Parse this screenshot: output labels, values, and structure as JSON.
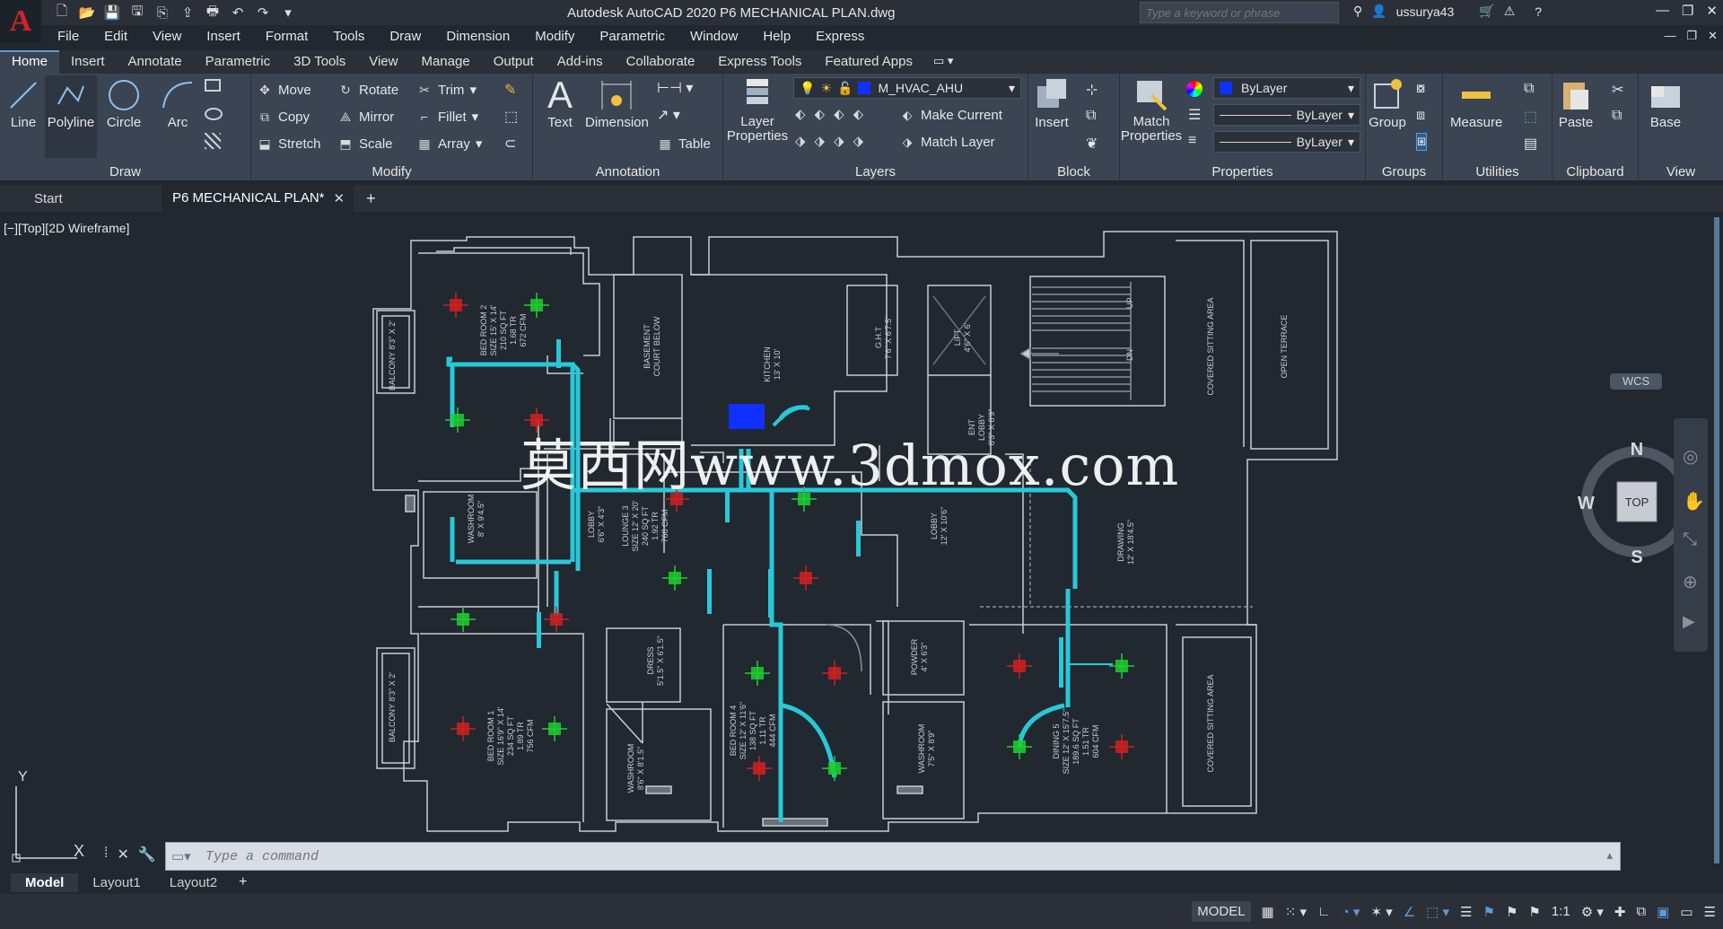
{
  "app": {
    "title": "Autodesk AutoCAD 2020    P6 MECHANICAL PLAN.dwg",
    "search_placeholder": "Type a keyword or phrase",
    "username": "ussurya43",
    "logo": "A"
  },
  "menu": [
    "File",
    "Edit",
    "View",
    "Insert",
    "Format",
    "Tools",
    "Draw",
    "Dimension",
    "Modify",
    "Parametric",
    "Window",
    "Help",
    "Express"
  ],
  "ribbon_tabs": [
    "Home",
    "Insert",
    "Annotate",
    "Parametric",
    "3D Tools",
    "View",
    "Manage",
    "Output",
    "Add-ins",
    "Collaborate",
    "Express Tools",
    "Featured Apps"
  ],
  "ribbon": {
    "draw": {
      "label": "Draw",
      "line": "Line",
      "polyline": "Polyline",
      "circle": "Circle",
      "arc": "Arc"
    },
    "modify": {
      "label": "Modify",
      "move": "Move",
      "rotate": "Rotate",
      "trim": "Trim",
      "copy": "Copy",
      "mirror": "Mirror",
      "fillet": "Fillet",
      "stretch": "Stretch",
      "scale": "Scale",
      "array": "Array"
    },
    "annotation": {
      "label": "Annotation",
      "text": "Text",
      "dimension": "Dimension",
      "table": "Table"
    },
    "layers": {
      "label": "Layers",
      "layer_properties": "Layer Properties",
      "current_layer": "M_HVAC_AHU",
      "make_current": "Make Current",
      "match_layer": "Match Layer"
    },
    "block": {
      "label": "Block",
      "insert": "Insert"
    },
    "properties": {
      "label": "Properties",
      "match_properties": "Match Properties",
      "color": "ByLayer",
      "linetype": "ByLayer",
      "lineweight": "ByLayer"
    },
    "groups": {
      "label": "Groups",
      "group": "Group"
    },
    "utilities": {
      "label": "Utilities",
      "measure": "Measure"
    },
    "clipboard": {
      "label": "Clipboard",
      "paste": "Paste"
    },
    "view": {
      "label": "View",
      "base": "Base"
    }
  },
  "doc_tabs": [
    "Start",
    "P6 MECHANICAL PLAN*"
  ],
  "viewport_label": "[−][Top][2D Wireframe]",
  "watermark": "莫西网www.3dmox.com",
  "compass": {
    "n": "N",
    "s": "S",
    "e": "E",
    "w": "W",
    "top": "TOP",
    "wcs": "WCS"
  },
  "ucs": {
    "y": "Y",
    "x": "X"
  },
  "command_placeholder": "Type a command",
  "layout_tabs": [
    "Model",
    "Layout1",
    "Layout2"
  ],
  "status": {
    "model": "MODEL",
    "scale": "1:1"
  },
  "plan_labels": {
    "bed2": [
      "BED ROOM 2",
      "SIZE 15' X 14'",
      "210 SQ FT",
      "1.68 TR",
      "672 CFM"
    ],
    "basement": [
      "BASEMENT",
      "COURT BELOW"
    ],
    "kitchen": [
      "KITCHEN",
      "13' X 10'"
    ],
    "ghrt": [
      "G.H.T",
      "7'6\" X 6'7.5\""
    ],
    "lift": [
      "LIFT",
      "4'6\" X 6'"
    ],
    "ent_lobby": [
      "ENT",
      "LOBBY",
      "8'3\" X 8'9\""
    ],
    "covered1": "COVERED SITTING AREA",
    "open_terrace": "OPEN TERRACE",
    "balcony1": "BALCONY 8'3\" X 2'",
    "washroom1": [
      "WASHROOM",
      "8' X 9'4.5\""
    ],
    "lobby1": [
      "LOBBY",
      "6'6\" X 4'3\""
    ],
    "lounge": [
      "LOUNGE 3",
      "SIZE 12' X 20'",
      "240 SQ FT",
      "1.92 TR",
      "768 CFM"
    ],
    "lobby2": [
      "LOBBY",
      "12' X 10'6\""
    ],
    "drawing": [
      "DRAWING",
      "12' X 18'4.5\""
    ],
    "balcony2": "BALCONY 8'3\" X 2'",
    "dress": [
      "DRESS",
      "5'1.5\" X 6'1.5\""
    ],
    "powder": [
      "POWDER",
      "4' X 6'3\""
    ],
    "bed1": [
      "BED ROOM 1",
      "SIZE 16'9\" X 14'",
      "234 SQ FT",
      "1.89 TR",
      "756 CFM"
    ],
    "washroom2": [
      "WASHROOM",
      "8'6\" X 8'1.5\""
    ],
    "bed4": [
      "BED ROOM 4",
      "SIZE 12' X 11'6\"",
      "138 SQ FT",
      "1.11 TR",
      "444 CFM"
    ],
    "washroom3": [
      "WASHROOM",
      "7'5\" X 8'9\""
    ],
    "dining": [
      "DINING 5",
      "SIZE 12' X 15'7.5\"",
      "189.6 SQ FT",
      "1.51 TR",
      "604 CFM"
    ],
    "covered2": "COVERED SITTING AREA",
    "up": "UP",
    "dn": "DN"
  },
  "colors": {
    "duct": "#28c8d8",
    "supply": "#1fcf2f",
    "return": "#d02020",
    "wall": "#c8ccd2",
    "accent": "#5d9bd8"
  }
}
